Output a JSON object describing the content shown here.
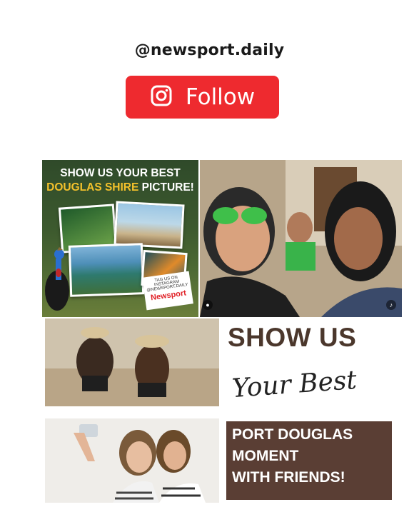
{
  "profile": {
    "handle": "@newsport.daily"
  },
  "follow_button": {
    "label": "Follow",
    "icon": "instagram-icon",
    "color": "#ee2a2f"
  },
  "posts": {
    "tile1": {
      "line1": "SHOW US YOUR BEST",
      "line2_part1": "DOUGLAS SHIRE",
      "line2_part2": " PICTURE!",
      "tag_line1": "TAG US ON INSTAGRAM",
      "tag_line2": "@NEWSPORT.DAILY",
      "tag_brand": "Newsport"
    },
    "tile4": {
      "heading": "SHOW US",
      "script": "Your Best",
      "box_line1": "PORT DOUGLAS",
      "box_line2": "MOMENT",
      "box_line3": "WITH FRIENDS!"
    }
  },
  "colors": {
    "brand_brown": "#5a3e34",
    "accent_yellow": "#f4c12b"
  }
}
